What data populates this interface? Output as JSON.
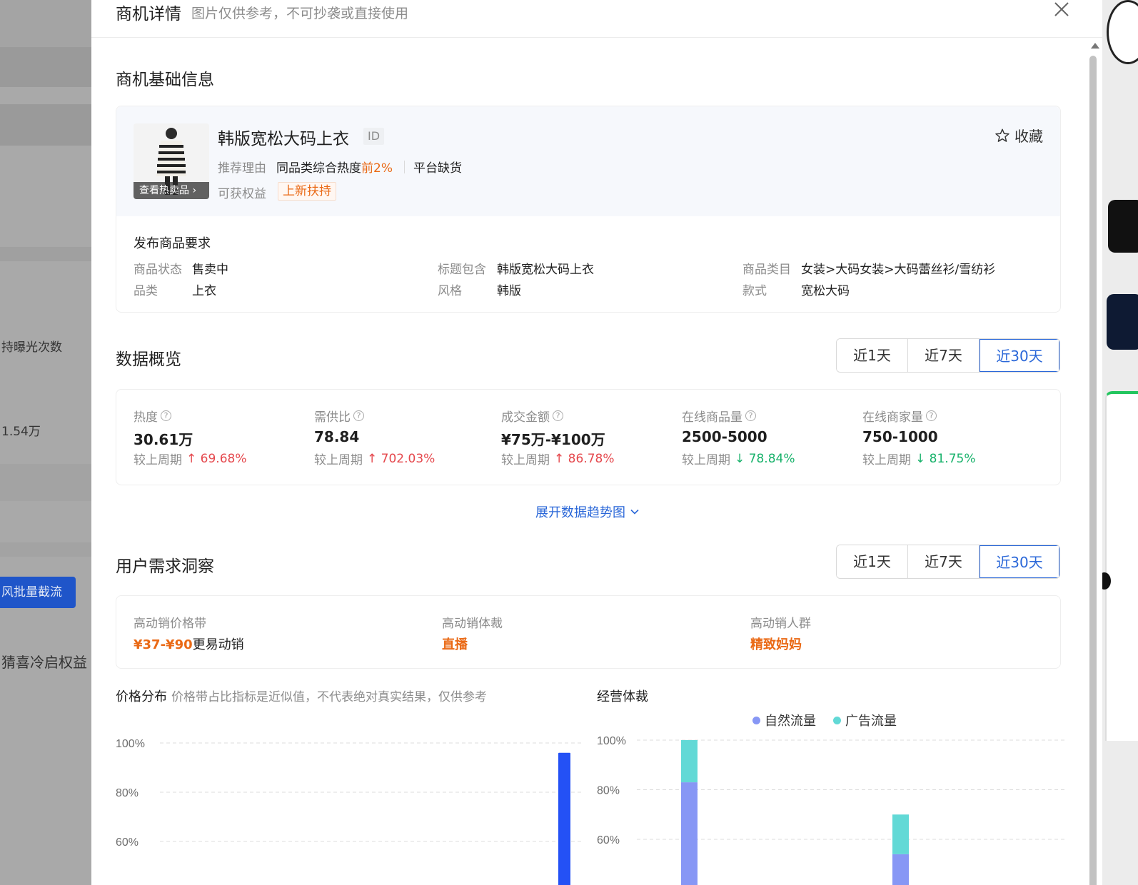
{
  "background": {
    "left_texts": [
      "持曝光次数",
      "1.54万",
      "猜喜冷启权益"
    ],
    "left_button": "风批量截流"
  },
  "modal": {
    "title": "商机详情",
    "subtitle": "图片仅供参考，不可抄袭或直接使用"
  },
  "base_info": {
    "section_title": "商机基础信息",
    "product_name": "韩版宽松大码上衣",
    "id_tag": "ID",
    "favorite_label": "收藏",
    "image_overlay": "查看热卖品",
    "reason_label": "推荐理由",
    "reason_text": "同品类综合热度",
    "reason_highlight": "前2%",
    "reason_extra": "平台缺货",
    "benefit_label": "可获权益",
    "benefit_tag": "上新扶持"
  },
  "requirements": {
    "title": "发布商品要求",
    "items": [
      {
        "label": "商品状态",
        "value": "售卖中"
      },
      {
        "label": "标题包含",
        "value": "韩版宽松大码上衣"
      },
      {
        "label": "商品类目",
        "value": "女装>大码女装>大码蕾丝衫/雪纺衫"
      },
      {
        "label": "品类",
        "value": "上衣"
      },
      {
        "label": "风格",
        "value": "韩版"
      },
      {
        "label": "款式",
        "value": "宽松大码"
      }
    ]
  },
  "overview": {
    "section_title": "数据概览",
    "ranges": [
      "近1天",
      "近7天",
      "近30天"
    ],
    "active_range": "近30天",
    "compare_label": "较上周期",
    "metrics": [
      {
        "label": "热度",
        "value": "30.61万",
        "change": "69.68%",
        "direction": "up"
      },
      {
        "label": "需供比",
        "value": "78.84",
        "change": "702.03%",
        "direction": "up"
      },
      {
        "label": "成交金额",
        "value": "¥75万-¥100万",
        "change": "86.78%",
        "direction": "up"
      },
      {
        "label": "在线商品量",
        "value": "2500-5000",
        "change": "78.84%",
        "direction": "down"
      },
      {
        "label": "在线商家量",
        "value": "750-1000",
        "change": "81.75%",
        "direction": "down"
      }
    ],
    "expand_link": "展开数据趋势图"
  },
  "insight": {
    "section_title": "用户需求洞察",
    "ranges": [
      "近1天",
      "近7天",
      "近30天"
    ],
    "active_range": "近30天",
    "items": [
      {
        "label": "高动销价格带",
        "highlight": "¥37-¥90",
        "suffix": "更易动销"
      },
      {
        "label": "高动销体裁",
        "highlight": "直播",
        "suffix": ""
      },
      {
        "label": "高动销人群",
        "highlight": "精致妈妈",
        "suffix": ""
      }
    ]
  },
  "charts": {
    "price": {
      "title": "价格分布",
      "note": "价格带占比指标是近似值，不代表绝对真实结果，仅供参考",
      "color": "#2451f5"
    },
    "mode": {
      "title": "经营体裁",
      "legend": [
        {
          "name": "自然流量",
          "color": "#8797f5"
        },
        {
          "name": "广告流量",
          "color": "#62d9d6"
        }
      ]
    }
  },
  "chart_data": [
    {
      "type": "bar",
      "title": "价格分布",
      "y_ticks": [
        "100%",
        "80%",
        "60%"
      ],
      "ylim": [
        0,
        100
      ],
      "y_unit": "%",
      "values_visible": [
        96
      ],
      "grid": true
    },
    {
      "type": "bar",
      "title": "经营体裁",
      "stacked": true,
      "y_ticks": [
        "100%",
        "80%",
        "60%"
      ],
      "ylim": [
        0,
        100
      ],
      "y_unit": "%",
      "series": [
        {
          "name": "自然流量",
          "values": [
            83,
            54
          ]
        },
        {
          "name": "广告流量",
          "values": [
            17,
            16
          ]
        }
      ],
      "grid": true,
      "legend": "top-center"
    }
  ]
}
